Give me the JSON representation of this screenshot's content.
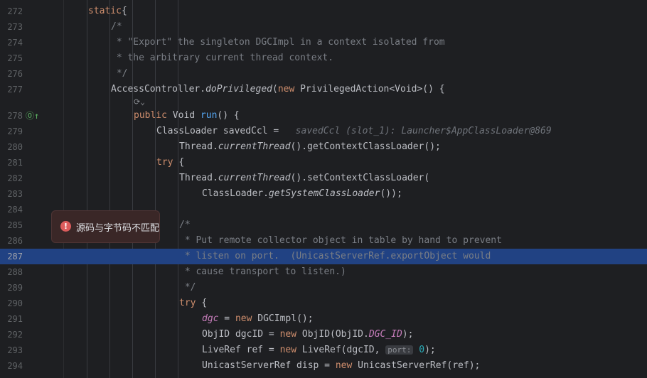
{
  "editor": {
    "lines": [
      {
        "n": "272",
        "indent": 1,
        "tokens": [
          [
            "kw",
            "static"
          ],
          [
            "",
            "{"
          ]
        ]
      },
      {
        "n": "273",
        "indent": 2,
        "tokens": [
          [
            "cm",
            "/*"
          ]
        ]
      },
      {
        "n": "274",
        "indent": 2,
        "tokens": [
          [
            "cm",
            " * \"Export\" the singleton DGCImpl in a context isolated from"
          ]
        ]
      },
      {
        "n": "275",
        "indent": 2,
        "tokens": [
          [
            "cm",
            " * the arbitrary current thread context."
          ]
        ]
      },
      {
        "n": "276",
        "indent": 2,
        "tokens": [
          [
            "cm",
            " */"
          ]
        ]
      },
      {
        "n": "277",
        "indent": 2,
        "tokens": [
          [
            "",
            "AccessController."
          ],
          [
            "it",
            "doPrivileged"
          ],
          [
            "",
            "("
          ],
          [
            "kw",
            "new "
          ],
          [
            "",
            "PrivilegedAction<Void>() {"
          ]
        ]
      },
      {
        "n": "278",
        "indent": 3,
        "tokens": [
          [
            "kw",
            "public "
          ],
          [
            "",
            "Void "
          ],
          [
            "fn",
            "run"
          ],
          [
            "",
            "() {"
          ]
        ]
      },
      {
        "n": "279",
        "indent": 4,
        "tokens": [
          [
            "",
            "ClassLoader savedCcl =  "
          ],
          [
            "hint",
            " savedCcl (slot_1): Launcher$AppClassLoader@869"
          ]
        ]
      },
      {
        "n": "280",
        "indent": 5,
        "tokens": [
          [
            "",
            "Thread."
          ],
          [
            "it",
            "currentThread"
          ],
          [
            "",
            "().getContextClassLoader();"
          ]
        ]
      },
      {
        "n": "281",
        "indent": 4,
        "tokens": [
          [
            "kw",
            "try "
          ],
          [
            "",
            "{"
          ]
        ]
      },
      {
        "n": "282",
        "indent": 5,
        "tokens": [
          [
            "",
            "Thread."
          ],
          [
            "it",
            "currentThread"
          ],
          [
            "",
            "().setContextClassLoader("
          ]
        ]
      },
      {
        "n": "283",
        "indent": 6,
        "tokens": [
          [
            "",
            "ClassLoader."
          ],
          [
            "it",
            "getSystemClassLoader"
          ],
          [
            "",
            "());"
          ]
        ]
      },
      {
        "n": "284",
        "indent": 0,
        "tokens": []
      },
      {
        "n": "285",
        "indent": 5,
        "tokens": [
          [
            "cm",
            "/*"
          ]
        ]
      },
      {
        "n": "286",
        "indent": 5,
        "tokens": [
          [
            "cm",
            " * Put remote collector object in table by hand to prevent"
          ]
        ]
      },
      {
        "n": "287",
        "indent": 5,
        "tokens": [
          [
            "cm",
            " * listen on port.  (UnicastServerRef.exportObject would"
          ]
        ]
      },
      {
        "n": "288",
        "indent": 5,
        "tokens": [
          [
            "cm",
            " * cause transport to listen.)"
          ]
        ]
      },
      {
        "n": "289",
        "indent": 5,
        "tokens": [
          [
            "cm",
            " */"
          ]
        ]
      },
      {
        "n": "290",
        "indent": 5,
        "tokens": [
          [
            "kw",
            "try "
          ],
          [
            "",
            "{"
          ]
        ]
      },
      {
        "n": "291",
        "indent": 6,
        "tokens": [
          [
            "st",
            "dgc"
          ],
          [
            "",
            " = "
          ],
          [
            "kw",
            "new "
          ],
          [
            "",
            "DGCImpl();"
          ]
        ]
      },
      {
        "n": "292",
        "indent": 6,
        "tokens": [
          [
            "",
            "ObjID dgcID = "
          ],
          [
            "kw",
            "new "
          ],
          [
            "",
            "ObjID(ObjID."
          ],
          [
            "st",
            "DGC_ID"
          ],
          [
            "",
            ");"
          ]
        ]
      },
      {
        "n": "293",
        "indent": 6,
        "tokens": [
          [
            "",
            "LiveRef ref = "
          ],
          [
            "kw",
            "new "
          ],
          [
            "",
            "LiveRef(dgcID, "
          ],
          [
            "inlay",
            "port:"
          ],
          [
            "num",
            " 0"
          ],
          [
            "",
            ");"
          ]
        ]
      },
      {
        "n": "294",
        "indent": 6,
        "tokens": [
          [
            "",
            "UnicastServerRef disp = "
          ],
          [
            "kw",
            "new "
          ],
          [
            "",
            "UnicastServerRef(ref);"
          ]
        ]
      }
    ],
    "highlighted_line": "287"
  },
  "tooltip": {
    "text": "源码与字节码不匹配"
  },
  "colors": {
    "highlight": "#214283",
    "error": "#db5c5c"
  }
}
